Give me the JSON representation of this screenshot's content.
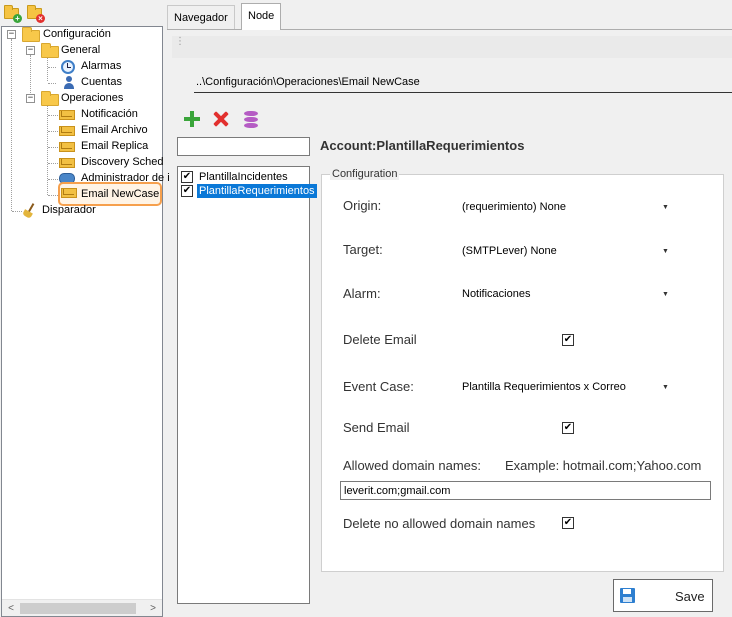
{
  "tree": {
    "nodes": [
      {
        "label": "Configuración",
        "expander": "−"
      },
      {
        "label": "General",
        "expander": "−"
      },
      {
        "label": "Alarmas"
      },
      {
        "label": "Cuentas"
      },
      {
        "label": "Operaciones",
        "expander": "−"
      },
      {
        "label": "Notificación"
      },
      {
        "label": "Email Archivo"
      },
      {
        "label": "Email Replica"
      },
      {
        "label": "Discovery Sched"
      },
      {
        "label": "Administrador de i"
      },
      {
        "label": "Email NewCase",
        "selected": true
      },
      {
        "label": "Disparador"
      }
    ],
    "scroll_left": "<",
    "scroll_right": ">"
  },
  "tabs": [
    {
      "label": "Navegador",
      "active": false
    },
    {
      "label": "Node",
      "active": true
    }
  ],
  "strip_grip": "⋮",
  "path": "..\\Configuración\\Operaciones\\Email NewCase",
  "search": {
    "value": ""
  },
  "account_title": "Account:PlantillaRequerimientos",
  "accounts": [
    {
      "label": "PlantillaIncidentes",
      "checked": "✔",
      "selected": false
    },
    {
      "label": "PlantillaRequerimientos",
      "checked": "✔",
      "selected": true
    }
  ],
  "config": {
    "legend": "Configuration",
    "origin_label": "Origin:",
    "origin_value": "(requerimiento) None",
    "target_label": "Target:",
    "target_value": "(SMTPLever) None",
    "alarm_label": "Alarm:",
    "alarm_value": "Notificaciones",
    "delete_email_label": "Delete Email",
    "delete_email_checked": "✔",
    "event_case_label": "Event Case:",
    "event_case_value": "Plantilla Requerimientos x Correo",
    "send_email_label": "Send Email",
    "send_email_checked": "✔",
    "allowed_domains_label": "Allowed domain names:",
    "allowed_domains_example": "Example: hotmail.com;Yahoo.com",
    "allowed_domains_value": "leverit.com;gmail.com",
    "delete_no_allowed_label": "Delete no allowed domain names",
    "delete_no_allowed_checked": "✔",
    "dropdown_arrow": "▼"
  },
  "save_label": "Save",
  "colors": {
    "selection": "#0a78d7",
    "highlight_border": "#f6a04d",
    "add": "#3aa53a",
    "delete": "#e2302e",
    "database": "#b55cc4"
  }
}
